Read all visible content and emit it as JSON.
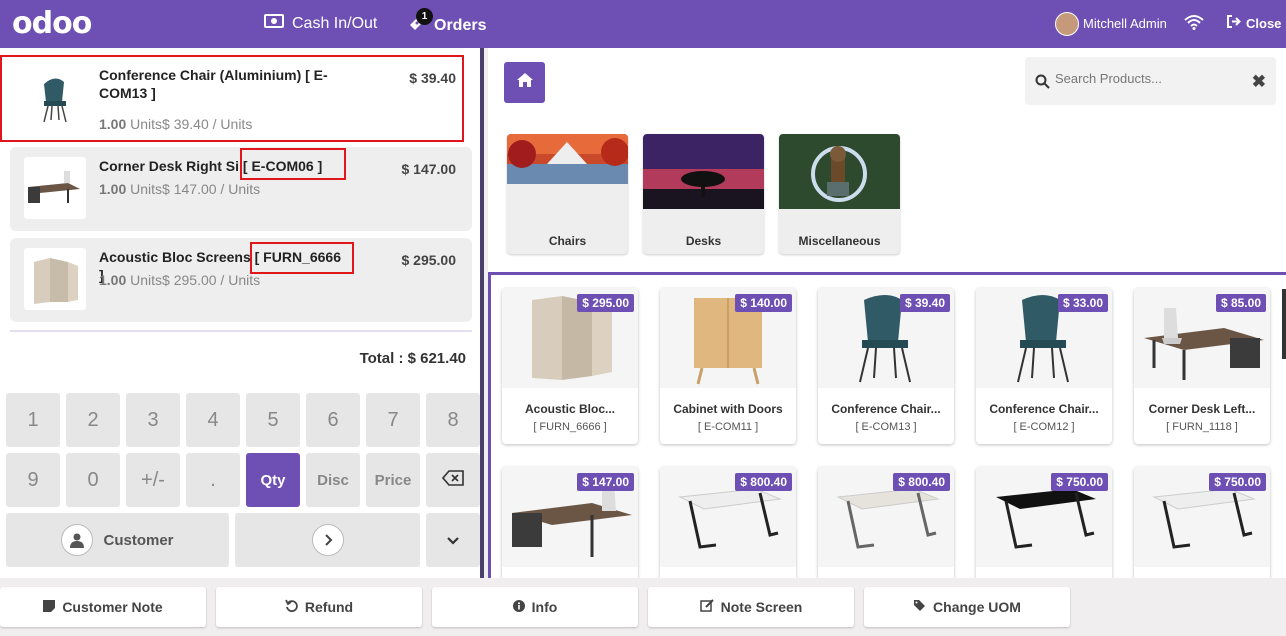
{
  "app": {
    "logo": "odoo"
  },
  "topbar": {
    "cash_label": "Cash In/Out",
    "orders_label": "Orders",
    "orders_badge": "1",
    "user_name": "Mitchell Admin",
    "close_label": "Close",
    "accent": "#6e4fb4"
  },
  "order": {
    "lines": [
      {
        "name": "Conference Chair (Aluminium) [ E-COM13 ]",
        "qty": "1.00",
        "unit_text": "Units$ 39.40 / Units",
        "price": "$ 39.40"
      },
      {
        "name": "Corner Desk Right Si",
        "ref": "[ E-COM06 ]",
        "qty": "1.00",
        "unit_text": "Units$ 147.00 / Units",
        "price": "$ 147.00"
      },
      {
        "name": "Acoustic Bloc Screens",
        "ref": "[ FURN_6666 ]",
        "qty": "1.00",
        "unit_text": "Units$ 295.00 / Units",
        "price": "$ 295.00"
      }
    ],
    "total_label": "Total : $ 621.40"
  },
  "numpad": {
    "k1": "1",
    "k2": "2",
    "k3": "3",
    "k4": "4",
    "k5": "5",
    "k6": "6",
    "k7": "7",
    "k8": "8",
    "k9": "9",
    "k0": "0",
    "sign": "+/-",
    "dot": ".",
    "qty": "Qty",
    "disc": "Disc",
    "price": "Price",
    "customer": "Customer"
  },
  "search": {
    "placeholder": "Search Products..."
  },
  "categories": [
    {
      "label": "Chairs"
    },
    {
      "label": "Desks"
    },
    {
      "label": "Miscellaneous"
    }
  ],
  "products": [
    {
      "name": "Acoustic Bloc...",
      "ref": "[ FURN_6666 ]",
      "price": "$ 295.00"
    },
    {
      "name": "Cabinet with Doors",
      "ref": "[ E-COM11 ]",
      "price": "$ 140.00"
    },
    {
      "name": "Conference Chair...",
      "ref": "[ E-COM13 ]",
      "price": "$ 39.40"
    },
    {
      "name": "Conference Chair...",
      "ref": "[ E-COM12 ]",
      "price": "$ 33.00"
    },
    {
      "name": "Corner Desk Left...",
      "ref": "[ FURN_1118 ]",
      "price": "$ 85.00"
    },
    {
      "price": "$ 147.00"
    },
    {
      "price": "$ 800.40"
    },
    {
      "price": "$ 800.40"
    },
    {
      "price": "$ 750.00"
    },
    {
      "price": "$ 750.00"
    }
  ],
  "controls": {
    "customer_note": "Customer Note",
    "refund": "Refund",
    "info": "Info",
    "note_screen": "Note Screen",
    "change_uom": "Change UOM"
  }
}
